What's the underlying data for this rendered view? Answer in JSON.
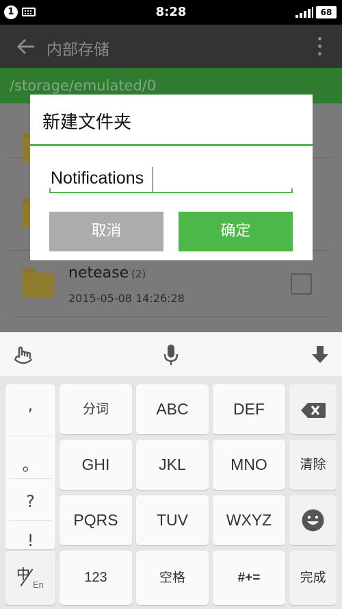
{
  "status_bar": {
    "badge": "1",
    "time": "8:28",
    "battery": "68"
  },
  "toolbar": {
    "title": "内部存储"
  },
  "path": "/storage/emulated/0",
  "file_list": {
    "items": [
      {
        "name": "netease",
        "count": "(2)",
        "date": "2015-05-08 14:26:28"
      }
    ]
  },
  "dialog": {
    "title": "新建文件夹",
    "input_value": "Notifications",
    "cancel_label": "取消",
    "ok_label": "确定"
  },
  "keyboard": {
    "punctuation": [
      ",",
      "。",
      "?",
      "!"
    ],
    "rows": [
      [
        "分词",
        "ABC",
        "DEF"
      ],
      [
        "GHI",
        "JKL",
        "MNO",
        "清除"
      ],
      [
        "PQRS",
        "TUV",
        "WXYZ"
      ]
    ],
    "bottom": {
      "lang_main": "中",
      "lang_sub": "En",
      "num": "123",
      "space": "空格",
      "symbols": "#+=",
      "done": "完成"
    }
  },
  "colors": {
    "accent": "#4cb84a",
    "toolbar": "#333333",
    "cancel": "#acacac"
  }
}
